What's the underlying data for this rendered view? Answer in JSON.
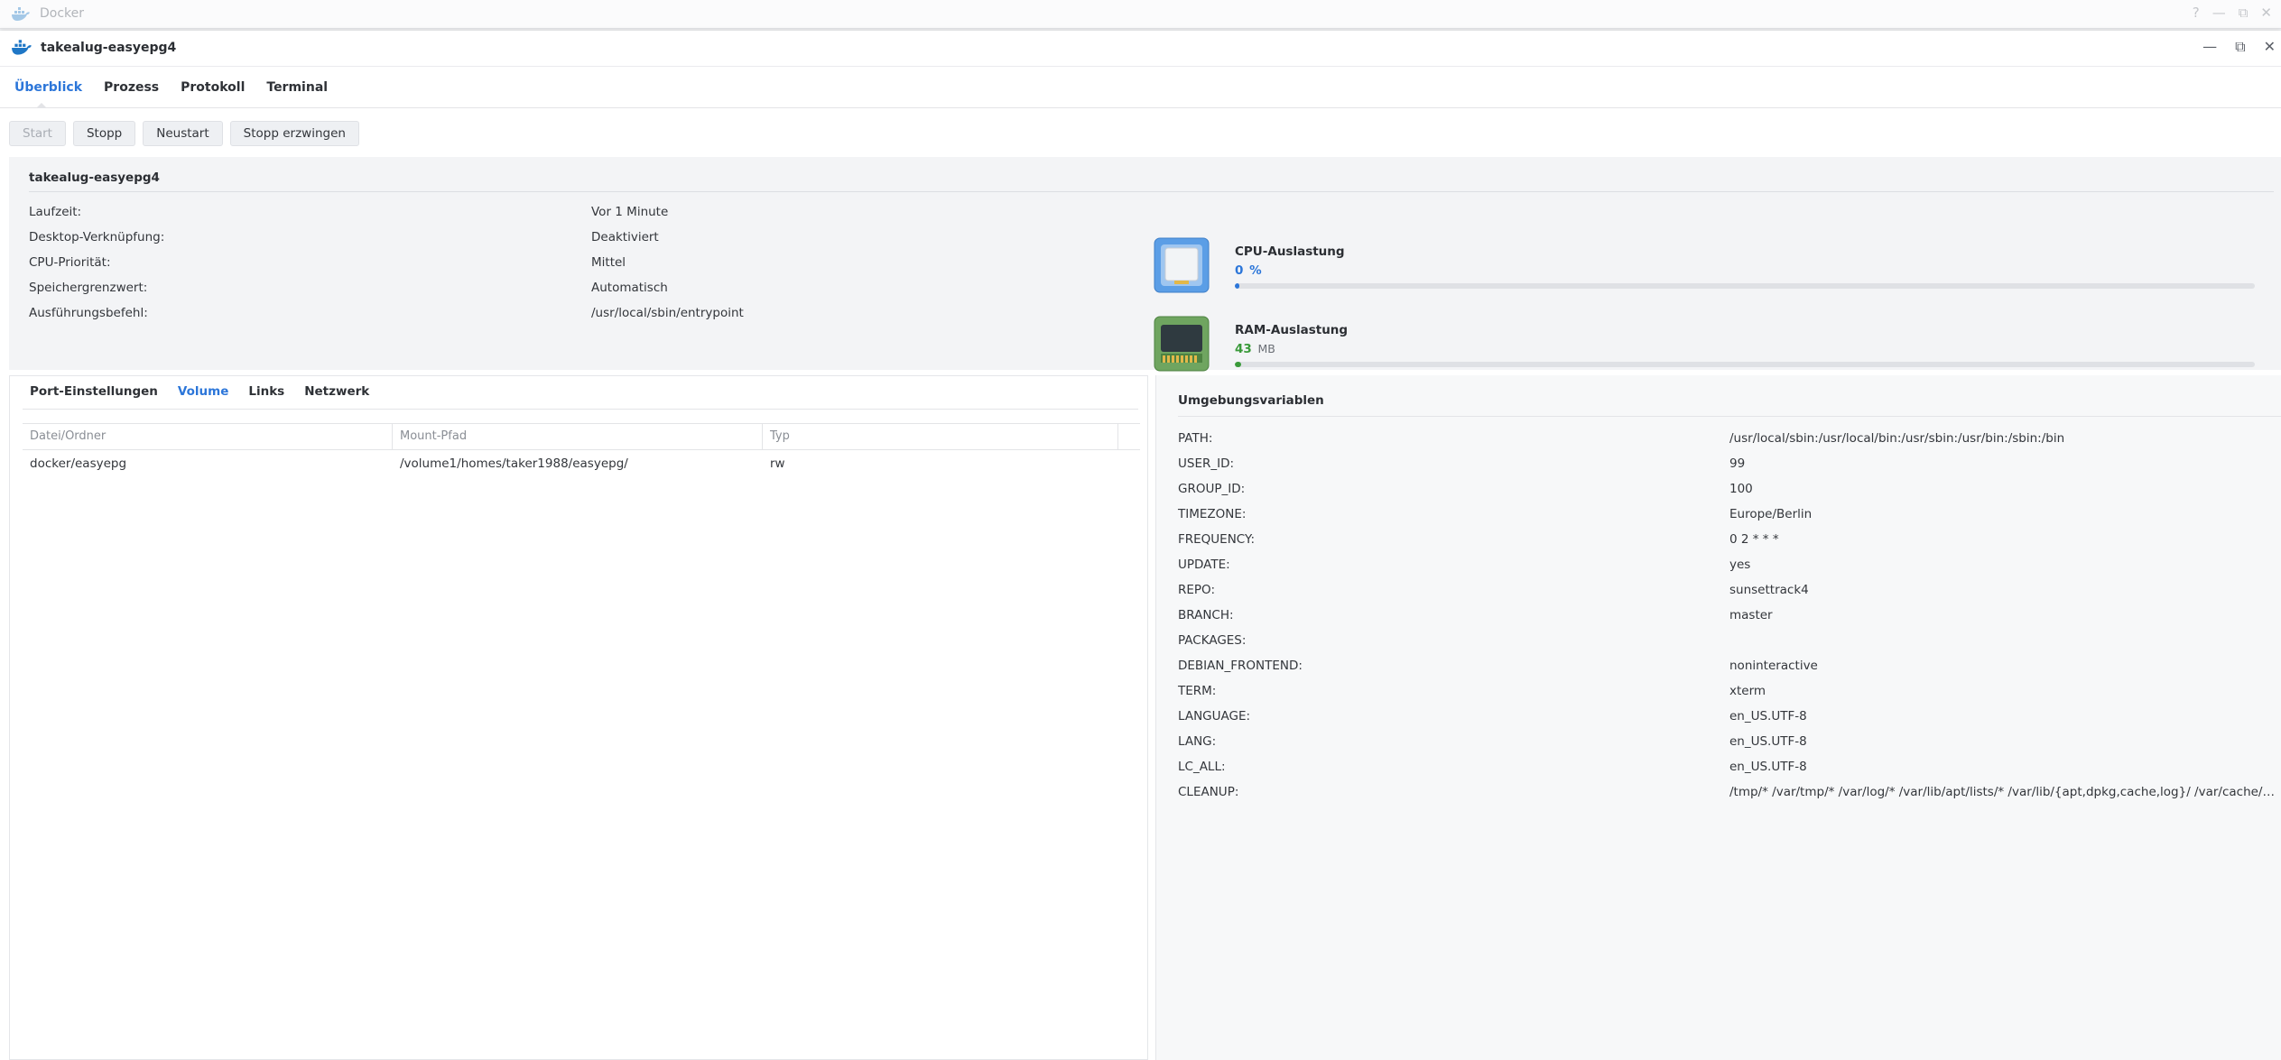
{
  "outer": {
    "title": "Docker",
    "controls": [
      "?",
      "—",
      "⧉",
      "✕"
    ]
  },
  "window": {
    "title": "takealug-easyepg4",
    "controls": [
      "—",
      "⧉",
      "✕"
    ]
  },
  "tabs": [
    {
      "label": "Überblick",
      "active": true
    },
    {
      "label": "Prozess",
      "active": false
    },
    {
      "label": "Protokoll",
      "active": false
    },
    {
      "label": "Terminal",
      "active": false
    }
  ],
  "toolbar": {
    "start": "Start",
    "stop": "Stopp",
    "restart": "Neustart",
    "force_stop": "Stopp erzwingen"
  },
  "overview": {
    "name": "takealug-easyepg4",
    "rows": [
      {
        "key": "Laufzeit:",
        "value": "Vor 1 Minute"
      },
      {
        "key": "Desktop-Verknüpfung:",
        "value": "Deaktiviert"
      },
      {
        "key": "CPU-Priorität:",
        "value": "Mittel"
      },
      {
        "key": "Speichergrenzwert:",
        "value": "Automatisch"
      },
      {
        "key": "Ausführungsbefehl:",
        "value": "/usr/local/sbin/entrypoint"
      }
    ],
    "cpu": {
      "label": "CPU-Auslastung",
      "value": "0",
      "unit": "%",
      "fraction": 0.004,
      "color": "#2c76d9"
    },
    "ram": {
      "label": "RAM-Auslastung",
      "value": "43",
      "unit": "MB",
      "fraction": 0.006,
      "color": "#3a9a3a"
    }
  },
  "bottom_left": {
    "tabs": [
      {
        "label": "Port-Einstellungen",
        "active": false
      },
      {
        "label": "Volume",
        "active": true
      },
      {
        "label": "Links",
        "active": false
      },
      {
        "label": "Netzwerk",
        "active": false
      }
    ],
    "columns": [
      "Datei/Ordner",
      "Mount-Pfad",
      "Typ"
    ],
    "rows": [
      [
        "docker/easyepg",
        "/volume1/homes/taker1988/easyepg/",
        "rw"
      ]
    ]
  },
  "env": {
    "title": "Umgebungsvariablen",
    "vars": [
      {
        "key": "PATH:",
        "value": "/usr/local/sbin:/usr/local/bin:/usr/sbin:/usr/bin:/sbin:/bin"
      },
      {
        "key": "USER_ID:",
        "value": "99"
      },
      {
        "key": "GROUP_ID:",
        "value": "100"
      },
      {
        "key": "TIMEZONE:",
        "value": "Europe/Berlin"
      },
      {
        "key": "FREQUENCY:",
        "value": "0 2 * * *"
      },
      {
        "key": "UPDATE:",
        "value": "yes"
      },
      {
        "key": "REPO:",
        "value": "sunsettrack4"
      },
      {
        "key": "BRANCH:",
        "value": "master"
      },
      {
        "key": "PACKAGES:",
        "value": ""
      },
      {
        "key": "DEBIAN_FRONTEND:",
        "value": "noninteractive"
      },
      {
        "key": "TERM:",
        "value": "xterm"
      },
      {
        "key": "LANGUAGE:",
        "value": "en_US.UTF-8"
      },
      {
        "key": "LANG:",
        "value": "en_US.UTF-8"
      },
      {
        "key": "LC_ALL:",
        "value": "en_US.UTF-8"
      },
      {
        "key": "CLEANUP:",
        "value": "/tmp/* /var/tmp/* /var/log/* /var/lib/apt/lists/* /var/lib/{apt,dpkg,cache,log}/ /var/cache/apt/archives"
      }
    ]
  }
}
